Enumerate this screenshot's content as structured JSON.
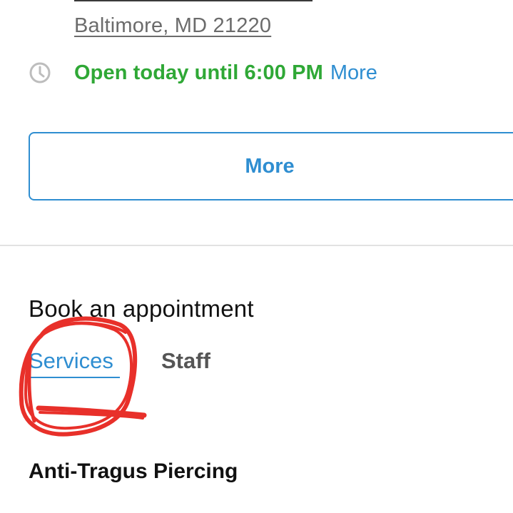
{
  "location": {
    "city_line": "Baltimore, MD 21220",
    "hours_status": "Open today until 6:00 PM",
    "hours_more": "More"
  },
  "actions": {
    "more_button_label": "More"
  },
  "booking": {
    "title": "Book an appointment",
    "tabs": [
      {
        "label": "Services",
        "selected": true
      },
      {
        "label": "Staff",
        "selected": false
      }
    ]
  },
  "service": {
    "title": "Anti-Tragus Piercing"
  },
  "icons": {
    "hours": "clock-icon"
  },
  "colors": {
    "accent_blue": "#2f8ed1",
    "open_green": "#2fa836",
    "annotation_red": "#e8302a",
    "divider": "#e2e2e2"
  }
}
